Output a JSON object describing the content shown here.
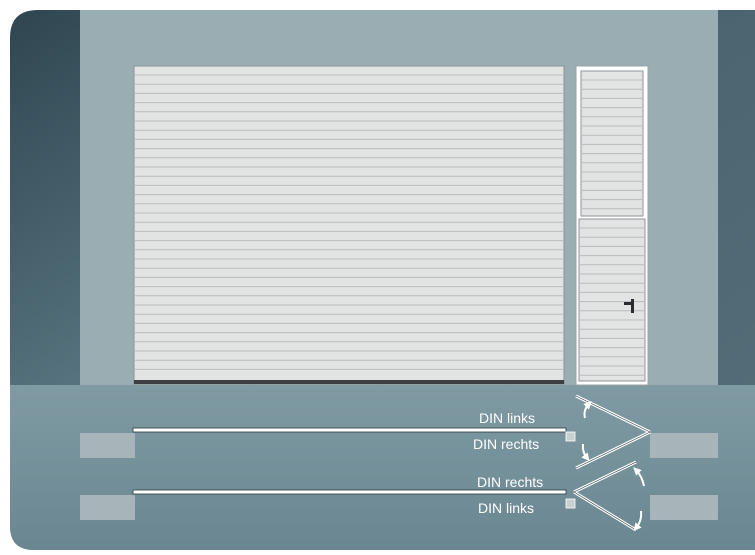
{
  "labels": {
    "upper_top": "DIN links",
    "upper_bottom": "DIN rechts",
    "lower_top": "DIN rechts",
    "lower_bottom": "DIN links"
  },
  "colors": {
    "panel_dark": "#2f4650",
    "panel_mid": "#6b8994",
    "wall": "#9aadb3",
    "floor_top": "#7f9aa3",
    "floor_bottom": "#6a8791",
    "door_panel": "#e2e3e3",
    "door_rib": "#bdbfbf",
    "frame": "#ffffff",
    "floor_block": "#a7b5ba",
    "arrow": "#ffffff"
  },
  "icons": [
    "door-handle-icon",
    "swing-arrow-icon"
  ]
}
